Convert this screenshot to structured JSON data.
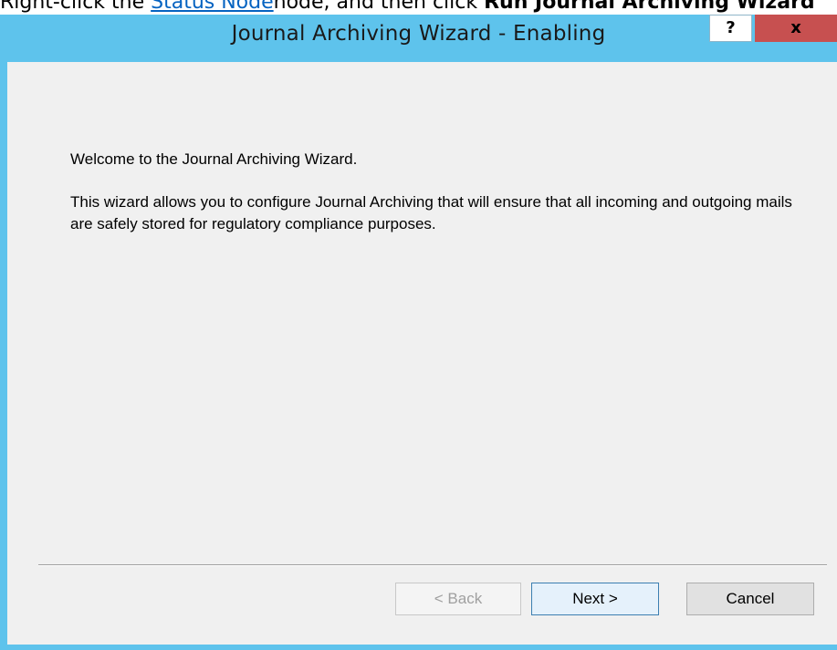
{
  "doc_instruction": {
    "prefix": "Right-click the ",
    "link": "Status Node",
    "middle": "node, and then click ",
    "bold": "Run Journal Archiving Wizard"
  },
  "window": {
    "title": "Journal Archiving Wizard - Enabling",
    "help_label": "?",
    "close_label": "x"
  },
  "wizard": {
    "welcome": "Welcome to the Journal Archiving Wizard.",
    "description": "This wizard allows you to configure Journal Archiving that will ensure that all incoming and outgoing mails are safely stored for regulatory compliance purposes."
  },
  "buttons": {
    "back": "< Back",
    "next": "Next >",
    "cancel": "Cancel"
  },
  "colors": {
    "titlebar": "#5ec3ec",
    "close": "#c75050",
    "background": "#f0f0f0",
    "next_border": "#3c7fb1"
  }
}
